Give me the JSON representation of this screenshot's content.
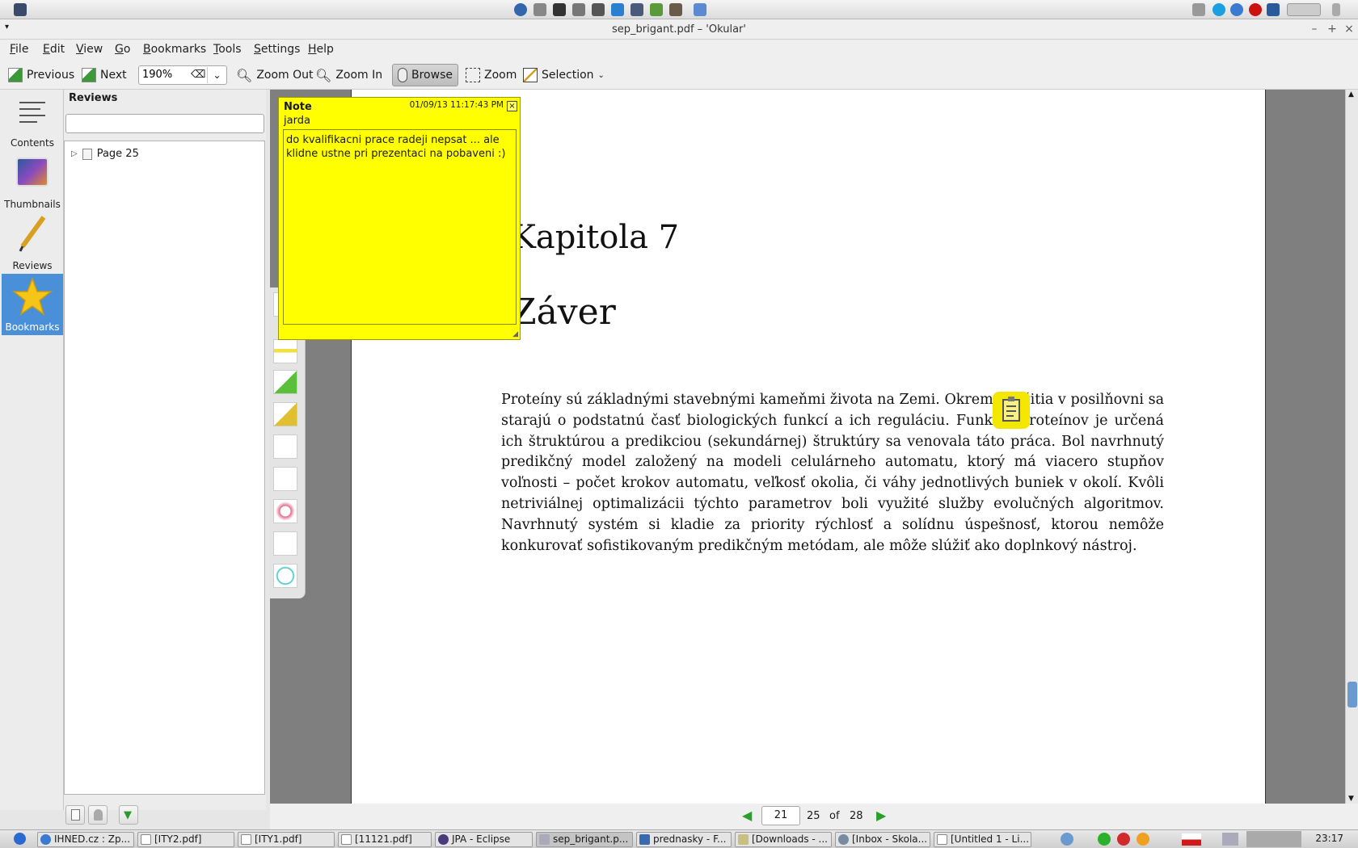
{
  "window": {
    "title": "sep_brigant.pdf – 'Okular'"
  },
  "menu": [
    "File",
    "Edit",
    "View",
    "Go",
    "Bookmarks",
    "Tools",
    "Settings",
    "Help"
  ],
  "toolbar": {
    "previous": "Previous",
    "next": "Next",
    "zoom_value": "190%",
    "zoom_out": "Zoom Out",
    "zoom_in": "Zoom In",
    "browse": "Browse",
    "zoom": "Zoom",
    "selection": "Selection"
  },
  "side_tabs": [
    {
      "label": "Contents",
      "icon": "contents-icon"
    },
    {
      "label": "Thumbnails",
      "icon": "thumbnails-icon"
    },
    {
      "label": "Reviews",
      "icon": "pencil-icon"
    },
    {
      "label": "Bookmarks",
      "icon": "star-icon",
      "active": true
    }
  ],
  "reviews": {
    "title": "Reviews",
    "search_value": "",
    "tree": [
      {
        "label": "Page 25"
      }
    ]
  },
  "note": {
    "title": "Note",
    "date": "01/09/13 11:17:43 PM",
    "author": "jarda",
    "text": "do kvalifikacni prace radeji nepsat ... ale klidne ustne pri prezentaci na pobaveni :)"
  },
  "document": {
    "chapter": "Kapitola 7",
    "section": "Záver",
    "paragraph": "Proteíny sú základnými stavebnými kameňmi života na Zemi. Okrem využitia v posilňovni sa starajú o podstatnú časť biologických funkcí a ich reguláciu. Funkcia proteínov je určená ich štruktúrou a predikciou (sekundárnej) štruktúry sa venovala táto práca. Bol navrhnutý predikčný model založený na modeli celulárneho automatu, ktorý má viacero stupňov voľnosti – počet krokov automatu, veľkosť okolia, či váhy jednotlivých buniek v okolí. Kvôli netriviálnej optimalizácii týchto parametrov boli využité služby evolučných algoritmov. Navrhnutý systém si kladie za priority rýchlosť a solídnu úspešnosť, ktorou nemôže konkurovať sofistikovaným predikčným metódam, ale môže slúžiť ako doplnkový nástroj."
  },
  "page_nav": {
    "current": "21",
    "page": "25",
    "of": "of",
    "total": "28"
  },
  "taskbar": {
    "tasks": [
      "IHNED.cz : Zp...",
      "[ITY2.pdf]",
      "[ITY1.pdf]",
      "[11121.pdf]",
      "JPA - Eclipse",
      "sep_brigant.p...",
      "prednasky - F...",
      "[Downloads - ...",
      "[Inbox - Skola...",
      "[Untitled 1 - Li..."
    ],
    "clock": "23:17"
  },
  "colors": {
    "note": "#ffff00",
    "active_tab": "#4a90d9",
    "nav_arrow": "#2aa02a"
  }
}
